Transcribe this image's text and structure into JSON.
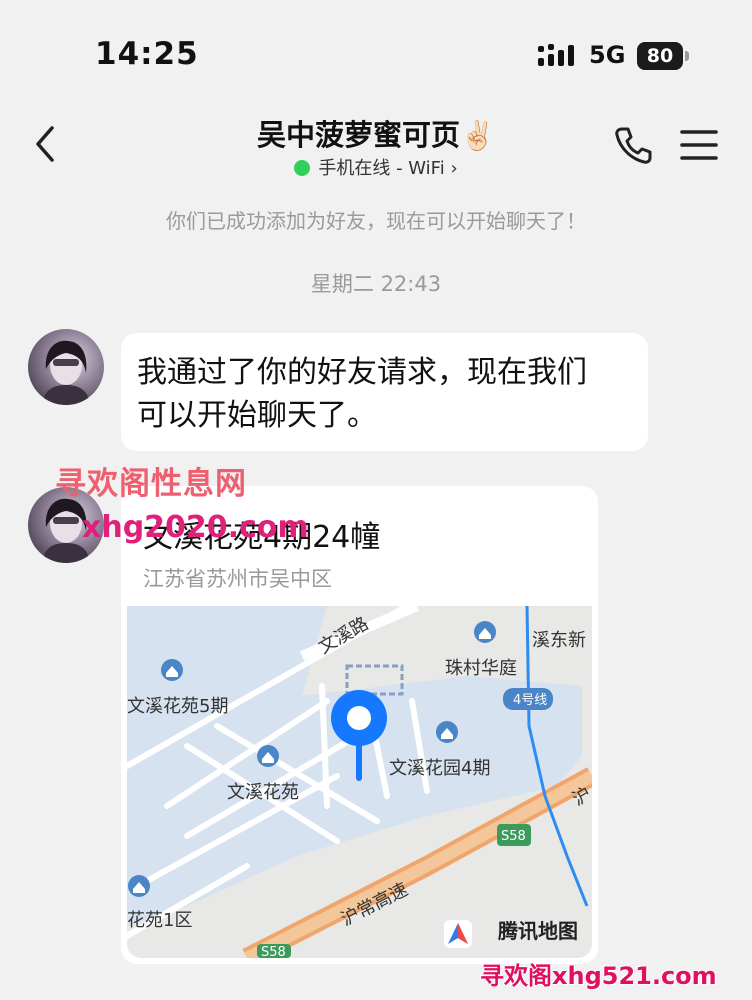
{
  "status_bar": {
    "time": "14:25",
    "network": "5G",
    "battery": "80"
  },
  "header": {
    "contact_name": "吴中菠萝蜜可页",
    "contact_emoji": "✌🏻",
    "presence": "手机在线 - WiFi ›",
    "presence_color": "#2fd05a"
  },
  "chat": {
    "system_message": "你们已成功添加为好友，现在可以开始聊天了！",
    "timestamp": "星期二 22:43",
    "messages": [
      {
        "type": "text",
        "text_line1": "我通过了你的好友请求，现在我们",
        "text_line2": "可以开始聊天了。"
      },
      {
        "type": "location",
        "name": "文溪花苑4期24幢",
        "address": "江苏省苏州市吴中区",
        "map": {
          "labels": {
            "road_wenxi": "文溪路",
            "xidong": "溪东新",
            "zhucun": "珠村华庭",
            "line4": "4号线",
            "wenxi5": "文溪花苑5期",
            "wenxi": "文溪花苑",
            "wenxi4": "文溪花园4期",
            "s58": "S58",
            "huchang": "沪常高速",
            "huyi": "花苑1区",
            "hu": "沪",
            "s58b": "S58"
          },
          "brand": "腾讯地图"
        }
      }
    ]
  },
  "watermarks": {
    "line1": "寻欢阁性息网",
    "line2": "xhg2020.com",
    "line3": "寻欢阁xhg521.com"
  }
}
